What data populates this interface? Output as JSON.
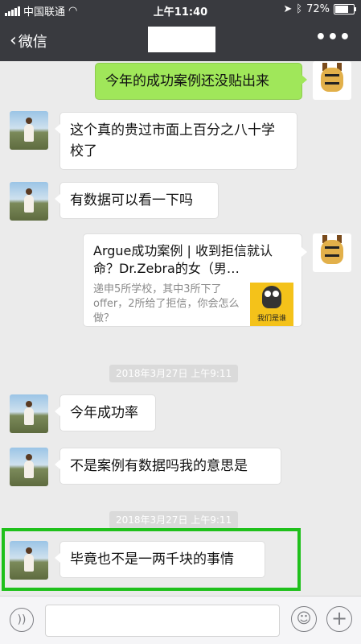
{
  "status_bar": {
    "carrier": "中国联通",
    "time": "上午11:40",
    "battery": "72%"
  },
  "nav": {
    "back_label": "微信",
    "more_label": "•••"
  },
  "messages": [
    {
      "side": "right",
      "text": "今年的成功案例还没贴出来"
    },
    {
      "side": "left",
      "text": "这个真的贵过市面上百分之八十学校了"
    },
    {
      "side": "left",
      "text": "有数据可以看一下吗"
    },
    {
      "side": "left",
      "text": "今年成功率"
    },
    {
      "side": "left",
      "text": "不是案例有数据吗我的意思是"
    },
    {
      "side": "left",
      "text": "毕竟也不是一两千块的事情"
    }
  ],
  "link_card": {
    "title": "Argue成功案例 | 收到拒信就认命？Dr.Zebra的女（男…",
    "description": "递申5所学校，其中3所下了offer，2所给了拒信，你会怎么做？",
    "thumb_text": "我们是谁"
  },
  "timestamps": [
    "2018年3月27日 上午9:11",
    "2018年3月27日 上午9:11"
  ],
  "input_bar": {
    "emoji_icon": "☺",
    "plus_icon": "+",
    "voice_icon": "))"
  }
}
